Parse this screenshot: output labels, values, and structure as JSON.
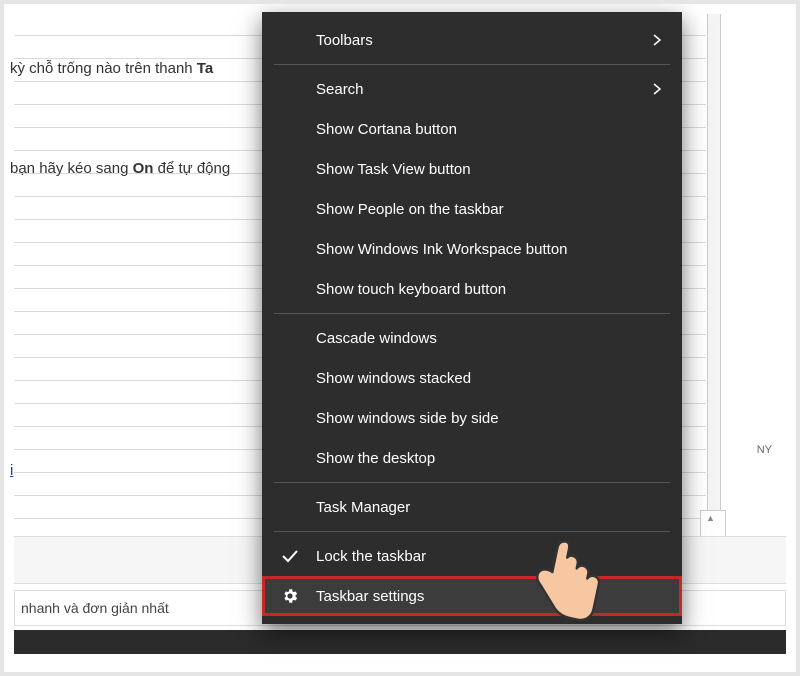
{
  "paper": {
    "line1_prefix": " kỳ chỗ trống nào trên thanh ",
    "line1_bold": "Ta",
    "line2_prefix": "bạn hãy kéo sang ",
    "line2_bold": "On",
    "line2_suffix": " để tự động",
    "link_text": "i",
    "ny": "NY",
    "bottom_text": "nhanh và đơn giản nhất"
  },
  "menu": {
    "toolbars": "Toolbars",
    "search": "Search",
    "show_cortana": "Show Cortana button",
    "show_taskview": "Show Task View button",
    "show_people": "Show People on the taskbar",
    "show_ink": "Show Windows Ink Workspace button",
    "show_touchkb": "Show touch keyboard button",
    "cascade": "Cascade windows",
    "stacked": "Show windows stacked",
    "sidebyside": "Show windows side by side",
    "desktop": "Show the desktop",
    "taskmgr": "Task Manager",
    "lock": "Lock the taskbar",
    "settings": "Taskbar settings"
  }
}
